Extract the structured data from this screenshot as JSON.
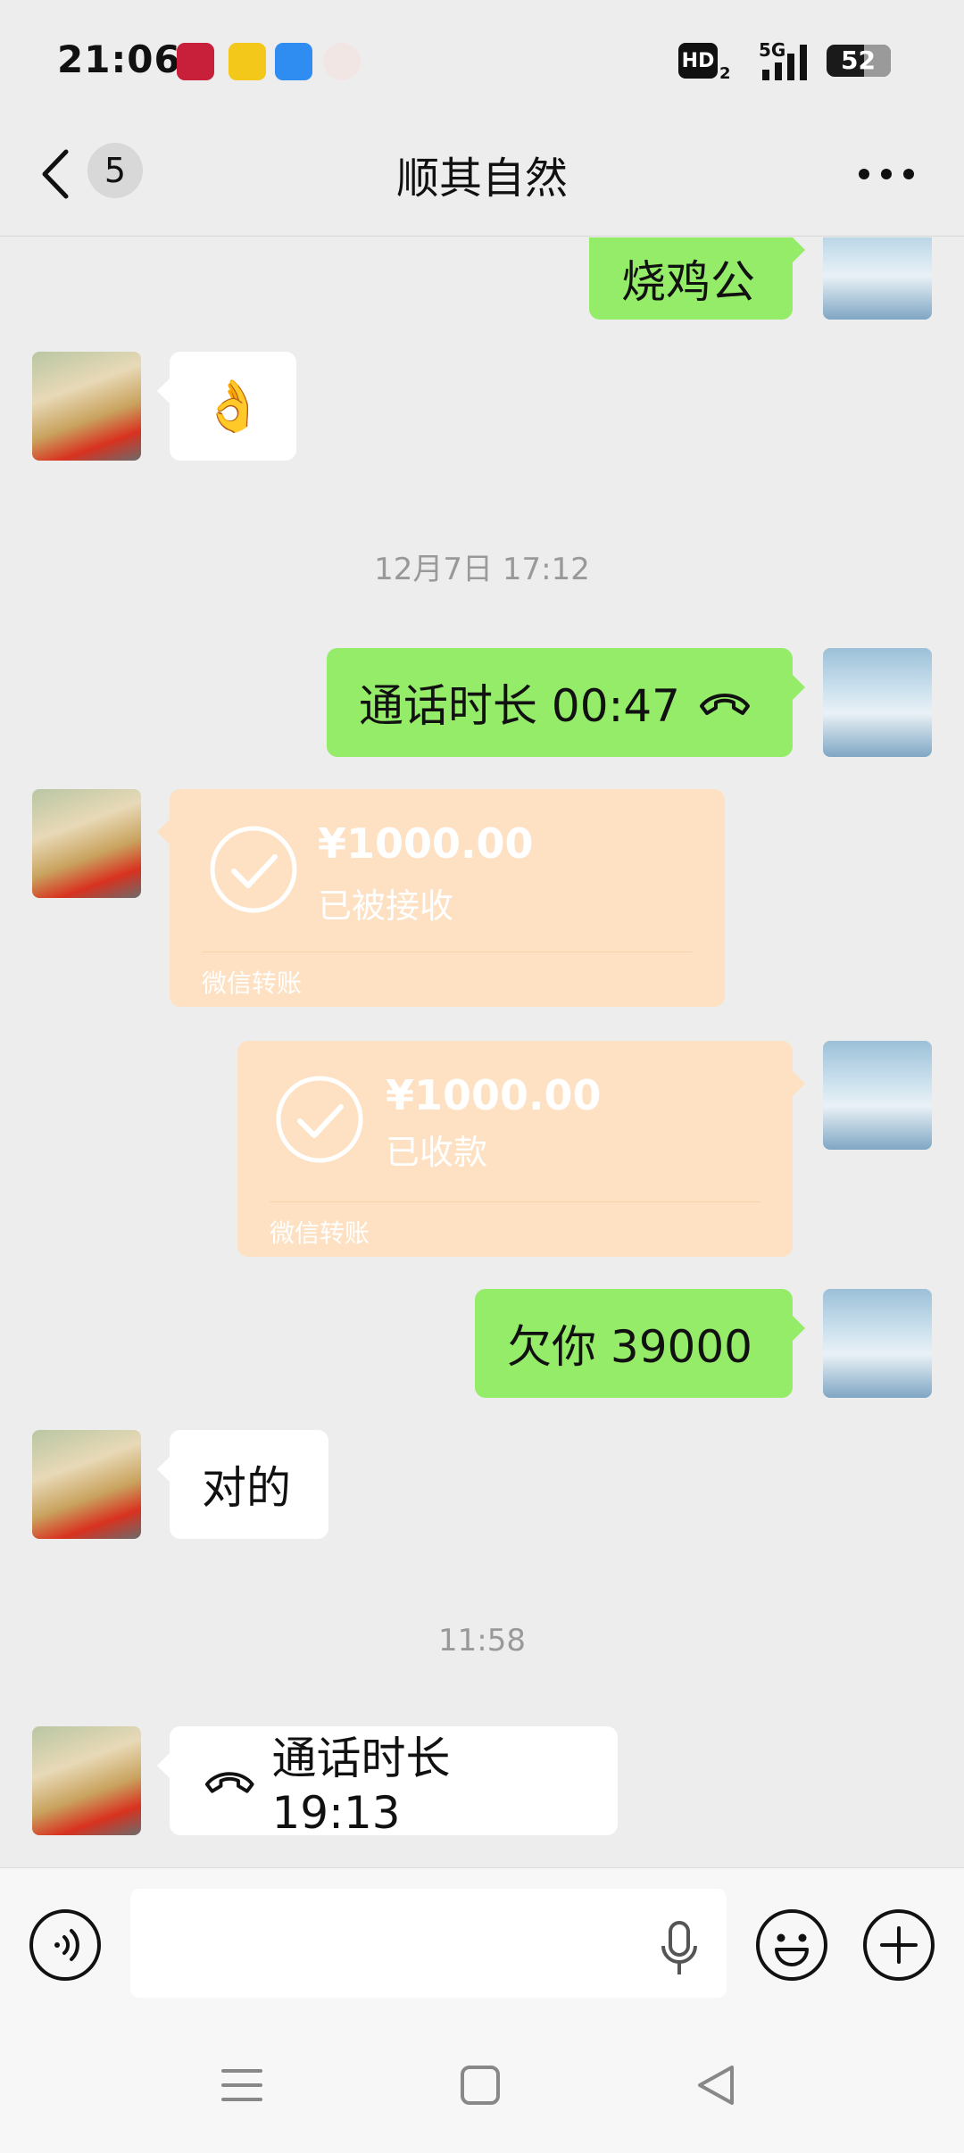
{
  "status_bar": {
    "time": "21:06",
    "hd": "HD",
    "hd_sub": "2",
    "network": "5G",
    "battery": "52",
    "notif_icons": [
      "app-icon-red",
      "app-icon-yellow",
      "app-icon-blue",
      "app-icon-avatar"
    ]
  },
  "nav": {
    "back_icon": "chevron-left-icon",
    "unread_count": "5",
    "title": "顺其自然",
    "more_icon": "more-horizontal-icon"
  },
  "messages": [
    {
      "side": "right",
      "type": "text",
      "text": "烧鸡公"
    },
    {
      "side": "left",
      "type": "emoji",
      "text": "👌"
    },
    {
      "type": "timestamp",
      "text": "12月7日 17:12"
    },
    {
      "side": "right",
      "type": "call",
      "text": "通话时长 00:47",
      "icon": "phone-hangup-icon"
    },
    {
      "side": "left",
      "type": "transfer",
      "amount": "¥1000.00",
      "status": "已被接收",
      "footer": "微信转账"
    },
    {
      "side": "right",
      "type": "transfer",
      "amount": "¥1000.00",
      "status": "已收款",
      "footer": "微信转账"
    },
    {
      "side": "right",
      "type": "text",
      "text": "欠你 39000"
    },
    {
      "side": "left",
      "type": "text",
      "text": "对的"
    },
    {
      "type": "timestamp",
      "text": "11:58"
    },
    {
      "side": "left",
      "type": "call",
      "text": "通话时长 19:13",
      "icon": "phone-hangup-icon"
    }
  ],
  "input_bar": {
    "voice_icon": "voice-mode-icon",
    "placeholder": "",
    "mic_icon": "microphone-icon",
    "emoji_icon": "emoji-icon",
    "plus_icon": "plus-icon"
  },
  "colors": {
    "chat_bg": "#ededed",
    "sent_bubble": "#95ec69",
    "received_bubble": "#ffffff",
    "transfer_card": "#fde1c2"
  },
  "system_nav": [
    "menu-icon",
    "home-square-icon",
    "back-triangle-icon"
  ]
}
